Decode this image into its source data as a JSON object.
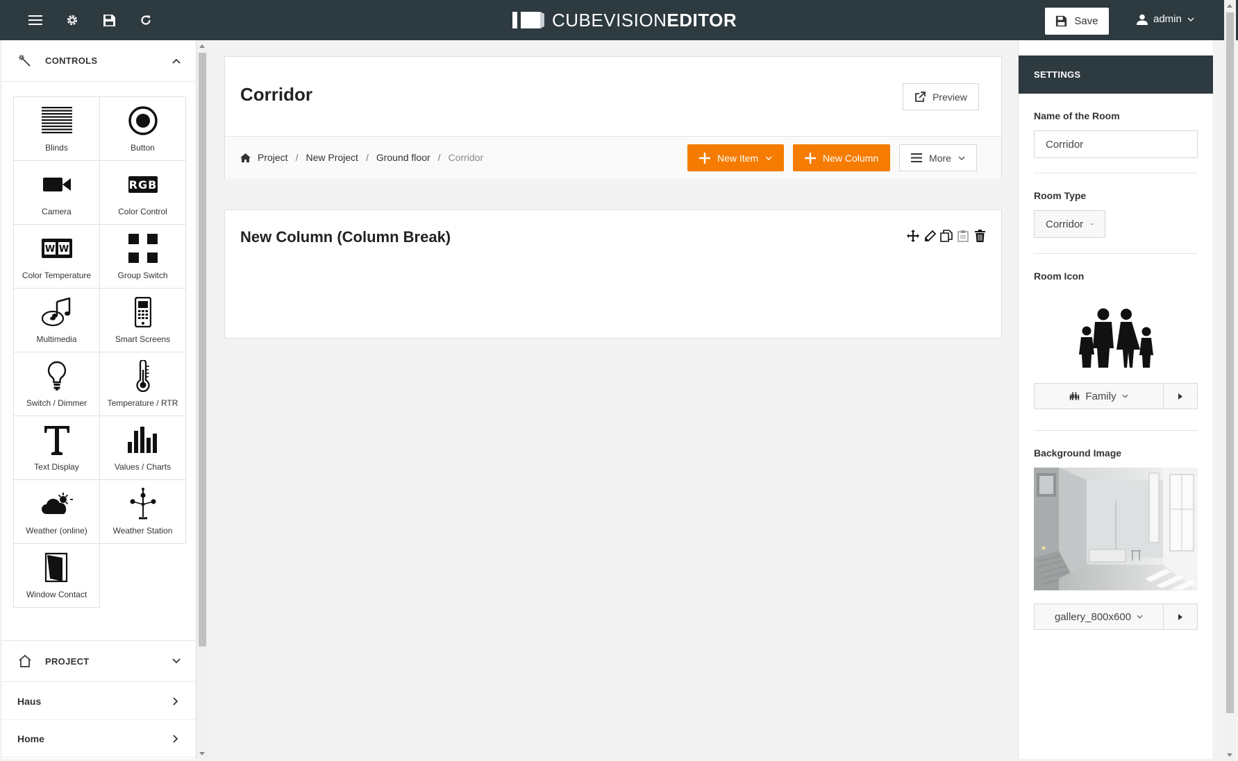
{
  "app": {
    "brand_light": "CUBEVISION",
    "brand_bold": "EDITOR",
    "save_label": "Save",
    "user_name": "admin"
  },
  "colors": {
    "topbar": "#2d3a40",
    "accent": "#f57c00"
  },
  "sidebar": {
    "controls_header": "CONTROLS",
    "controls": [
      {
        "label": "Blinds",
        "icon": "blinds-icon"
      },
      {
        "label": "Button",
        "icon": "radio-button-icon"
      },
      {
        "label": "Camera",
        "icon": "video-camera-icon"
      },
      {
        "label": "Color Control",
        "icon": "rgb-icon"
      },
      {
        "label": "Color Temperature",
        "icon": "white-white-icon"
      },
      {
        "label": "Group Switch",
        "icon": "grid-icon"
      },
      {
        "label": "Multimedia",
        "icon": "music-disc-icon"
      },
      {
        "label": "Smart Screens",
        "icon": "smartphone-icon"
      },
      {
        "label": "Switch / Dimmer",
        "icon": "light-bulb-icon"
      },
      {
        "label": "Temperature / RTR",
        "icon": "thermometer-icon"
      },
      {
        "label": "Text Display",
        "icon": "text-t-icon"
      },
      {
        "label": "Values / Charts",
        "icon": "bar-chart-icon"
      },
      {
        "label": "Weather (online)",
        "icon": "weather-cloud-icon"
      },
      {
        "label": "Weather Station",
        "icon": "weather-station-icon"
      },
      {
        "label": "Window Contact",
        "icon": "window-icon"
      }
    ],
    "project_header": "PROJECT",
    "project_items": [
      {
        "label": "Haus"
      },
      {
        "label": "Home"
      }
    ]
  },
  "main": {
    "title": "Corridor",
    "preview_label": "Preview",
    "breadcrumb": [
      "Project",
      "New Project",
      "Ground floor",
      "Corridor"
    ],
    "new_item_label": "New Item",
    "new_column_label": "New Column",
    "more_label": "More",
    "column_title": "New Column (Column Break)"
  },
  "settings": {
    "header": "SETTINGS",
    "name_label": "Name of the Room",
    "name_value": "Corridor",
    "type_label": "Room Type",
    "type_value": "Corridor",
    "icon_label": "Room Icon",
    "icon_value": "Family",
    "bg_label": "Background Image",
    "bg_value": "gallery_800x600"
  }
}
